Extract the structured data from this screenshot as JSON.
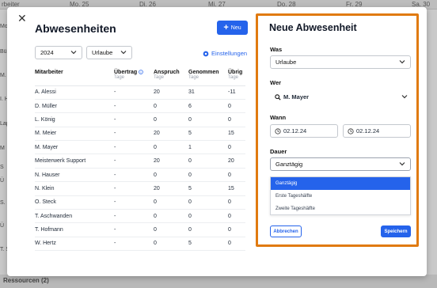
{
  "background": {
    "days": [
      "Mo. 25",
      "Di. 26",
      "Mi. 27",
      "Do. 28",
      "Fr. 29",
      "Sa. 30"
    ],
    "left_corner": "rbeiter",
    "row_labels": [
      "Mo",
      "Bü",
      "M. M",
      "I. H",
      "Lap",
      "M",
      "S",
      "Ü",
      "S. M",
      "Ü",
      "T. S"
    ],
    "footer": "Ressourcen (2)"
  },
  "left": {
    "title": "Abwesenheiten",
    "new_button_label": "Neu",
    "year_select": "2024",
    "type_select": "Urlaube",
    "settings_label": "Einstellungen",
    "columns": [
      {
        "label": "Mitarbeiter",
        "sub": ""
      },
      {
        "label": "Übertrag",
        "sub": "Tage"
      },
      {
        "label": "Anspruch",
        "sub": "Tage"
      },
      {
        "label": "Genommen",
        "sub": "Tage"
      },
      {
        "label": "Übrig",
        "sub": "Tage"
      }
    ],
    "rows": [
      [
        "A. Alessi",
        "-",
        "20",
        "31",
        "-11"
      ],
      [
        "D. Müller",
        "-",
        "0",
        "6",
        "0"
      ],
      [
        "L. König",
        "-",
        "0",
        "0",
        "0"
      ],
      [
        "M. Meier",
        "-",
        "20",
        "5",
        "15"
      ],
      [
        "M. Mayer",
        "-",
        "0",
        "1",
        "0"
      ],
      [
        "Meisterwerk Support",
        "-",
        "20",
        "0",
        "20"
      ],
      [
        "N. Hauser",
        "-",
        "0",
        "0",
        "0"
      ],
      [
        "N. Klein",
        "-",
        "20",
        "5",
        "15"
      ],
      [
        "O. Steck",
        "-",
        "0",
        "0",
        "0"
      ],
      [
        "T. Aschwanden",
        "-",
        "0",
        "0",
        "0"
      ],
      [
        "T. Hofmann",
        "-",
        "0",
        "0",
        "0"
      ],
      [
        "W. Hertz",
        "-",
        "0",
        "5",
        "0"
      ]
    ]
  },
  "right": {
    "title": "Neue Abwesenheit",
    "was_label": "Was",
    "was_value": "Urlaube",
    "wer_label": "Wer",
    "wer_value": "M. Mayer",
    "wann_label": "Wann",
    "date_from": "02.12.24",
    "date_to": "02.12.24",
    "dauer_label": "Dauer",
    "dauer_value": "Ganztägig",
    "dauer_options": [
      "Ganztägig",
      "Erste Tageshälfte",
      "Zweite Tageshälfte"
    ],
    "cancel_label": "Abbrechen",
    "save_label": "Speichern"
  },
  "colors": {
    "accent": "#2563eb",
    "highlight_border": "#e07a10"
  }
}
